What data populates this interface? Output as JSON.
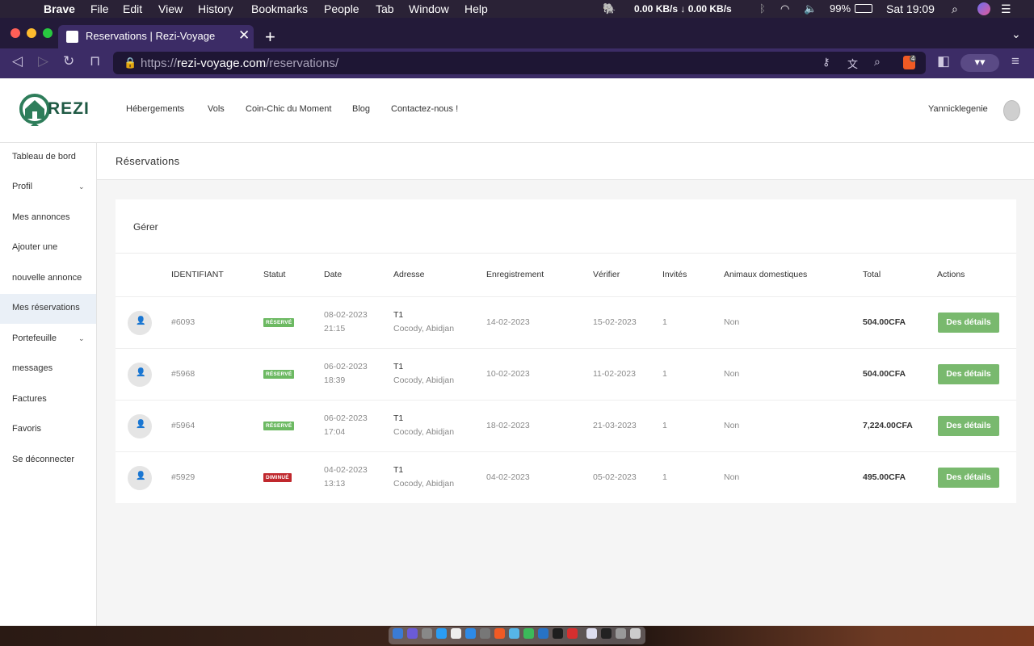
{
  "menubar": {
    "app": "Brave",
    "items": [
      "File",
      "Edit",
      "View",
      "History",
      "Bookmarks",
      "People",
      "Tab",
      "Window",
      "Help"
    ],
    "network": "0.00 KB/s ↓  0.00 KB/s",
    "battery": "99%",
    "clock": "Sat 19:09"
  },
  "browser": {
    "tab_title": "Reservations | Rezi-Voyage",
    "url_scheme": "https://",
    "url_domain": "rezi-voyage.com",
    "url_path": "/reservations/",
    "shield_count": "4"
  },
  "site": {
    "logo_text": "REZI",
    "nav": [
      "Hébergements",
      "Vols",
      "Coin-Chic du Moment",
      "Blog",
      "Contactez-nous !"
    ],
    "username": "Yannicklegenie"
  },
  "sidebar": {
    "items": [
      {
        "label": "Tableau de bord"
      },
      {
        "label": "Profil",
        "chevron": true
      },
      {
        "label": "Mes annonces"
      },
      {
        "label": "Ajouter une"
      },
      {
        "label": "nouvelle annonce"
      },
      {
        "label": "Mes réservations",
        "active": true
      },
      {
        "label": "Portefeuille",
        "chevron": true
      },
      {
        "label": "messages"
      },
      {
        "label": "Factures"
      },
      {
        "label": "Favoris"
      },
      {
        "label": "Se déconnecter"
      }
    ]
  },
  "page": {
    "title": "Réservations",
    "card_title": "Gérer"
  },
  "table": {
    "headers": [
      "IDENTIFIANT",
      "Statut",
      "Date",
      "Adresse",
      "Enregistrement",
      "Vérifier",
      "Invités",
      "Animaux domestiques",
      "Total",
      "Actions"
    ],
    "rows": [
      {
        "id": "#6093",
        "status": "RÉSERVÉ",
        "status_color": "#6cb962",
        "date": "08-02-2023",
        "time": "21:15",
        "addr1": "T1",
        "addr2": "Cocody, Abidjan",
        "checkin": "14-02-2023",
        "checkout": "15-02-2023",
        "guests": "1",
        "pets": "Non",
        "total": "504.00CFA",
        "action": "Des détails"
      },
      {
        "id": "#5968",
        "status": "RÉSERVÉ",
        "status_color": "#6cb962",
        "date": "06-02-2023",
        "time": "18:39",
        "addr1": "T1",
        "addr2": "Cocody, Abidjan",
        "checkin": "10-02-2023",
        "checkout": "11-02-2023",
        "guests": "1",
        "pets": "Non",
        "total": "504.00CFA",
        "action": "Des détails"
      },
      {
        "id": "#5964",
        "status": "RÉSERVÉ",
        "status_color": "#6cb962",
        "date": "06-02-2023",
        "time": "17:04",
        "addr1": "T1",
        "addr2": "Cocody, Abidjan",
        "checkin": "18-02-2023",
        "checkout": "21-03-2023",
        "guests": "1",
        "pets": "Non",
        "total": "7,224.00CFA",
        "action": "Des détails"
      },
      {
        "id": "#5929",
        "status": "DIMINUÉ",
        "status_color": "#c0282d",
        "date": "04-02-2023",
        "time": "13:13",
        "addr1": "T1",
        "addr2": "Cocody, Abidjan",
        "checkin": "04-02-2023",
        "checkout": "05-02-2023",
        "guests": "1",
        "pets": "Non",
        "total": "495.00CFA",
        "action": "Des détails"
      }
    ]
  }
}
